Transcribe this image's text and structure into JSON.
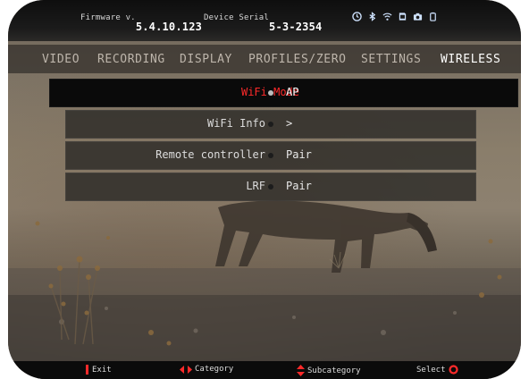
{
  "status_bar": {
    "firmware_label": "Firmware v.",
    "firmware_version": "5.4.10.123",
    "serial_label": "Device Serial",
    "serial_value": "5-3-2354",
    "icons": [
      "timer-icon",
      "bluetooth-icon",
      "wifi-icon",
      "sd-card-icon",
      "camera-icon",
      "battery-icon"
    ]
  },
  "tabs": [
    {
      "label": "VIDEO",
      "active": false
    },
    {
      "label": "RECORDING",
      "active": false
    },
    {
      "label": "DISPLAY",
      "active": false
    },
    {
      "label": "PROFILES/ZERO",
      "active": false
    },
    {
      "label": "SETTINGS",
      "active": false
    },
    {
      "label": "WIRELESS",
      "active": true
    }
  ],
  "menu": [
    {
      "label": "WiFi Mode",
      "value": "AP",
      "selected": true
    },
    {
      "label": "WiFi Info",
      "value": ">",
      "selected": false
    },
    {
      "label": "Remote controller",
      "value": "Pair",
      "selected": false
    },
    {
      "label": "LRF",
      "value": "Pair",
      "selected": false
    }
  ],
  "bottom_bar": {
    "exit": "Exit",
    "category": "Category",
    "subcategory": "Subcategory",
    "select": "Select"
  },
  "colors": {
    "accent": "#ff2a2a",
    "text": "#dcdcdc",
    "bar": "#0b0b0b"
  }
}
